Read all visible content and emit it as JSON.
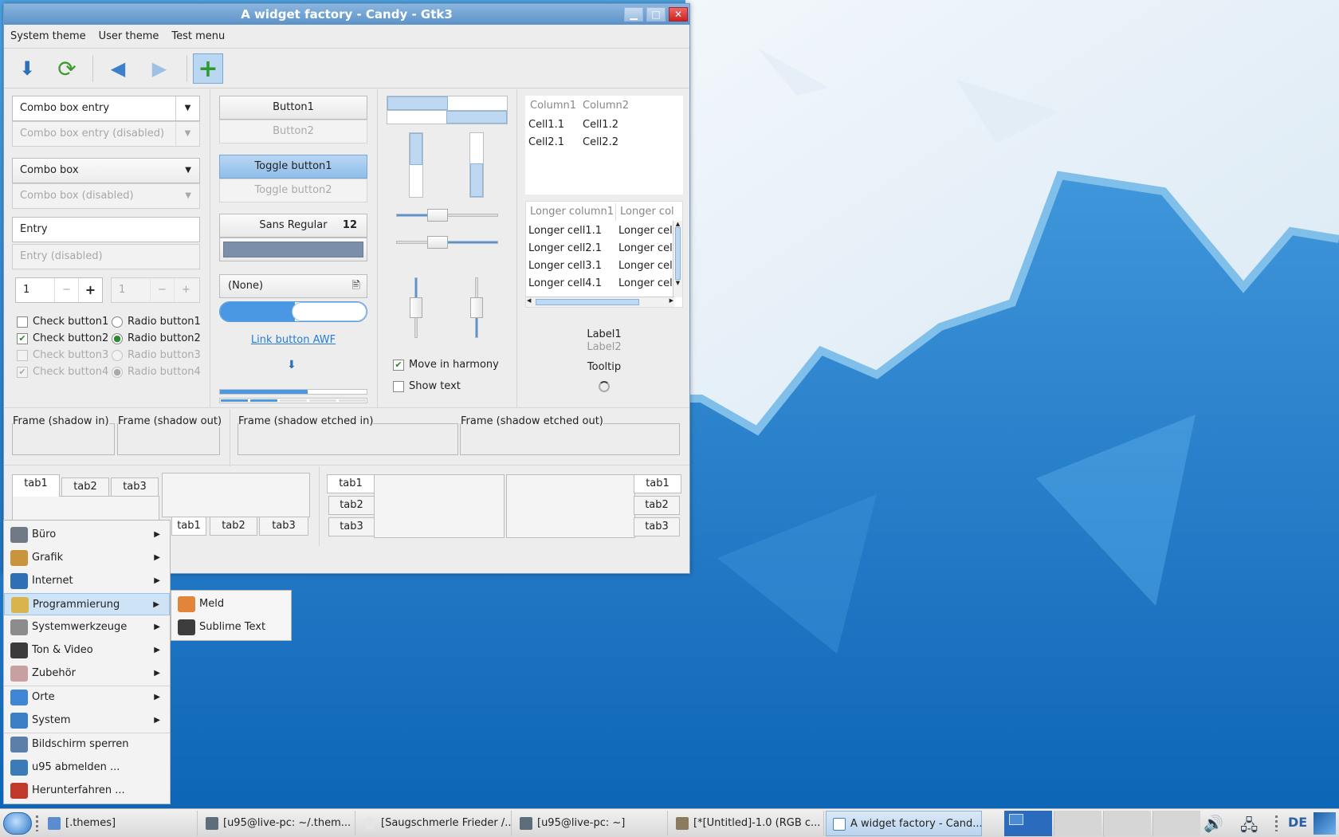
{
  "window": {
    "title": "A widget factory - Candy - Gtk3",
    "minimize_icon": "minimize-icon",
    "maximize_icon": "maximize-icon",
    "close_icon": "close-icon"
  },
  "menubar": {
    "items": [
      "System theme",
      "User theme",
      "Test menu"
    ]
  },
  "toolbar": {
    "icons": [
      "download-icon",
      "refresh-icon",
      "back-icon",
      "forward-icon",
      "add-icon"
    ]
  },
  "column1": {
    "combo_entry": "Combo box entry",
    "combo_entry_disabled": "Combo box entry (disabled)",
    "combo": "Combo box",
    "combo_disabled": "Combo box (disabled)",
    "entry": "Entry",
    "entry_disabled": "Entry (disabled)",
    "spin1_value": "1",
    "spin2_value": "1",
    "spin_minus": "−",
    "spin_plus": "+",
    "checks": [
      {
        "label": "Check button1",
        "checked": false,
        "disabled": false
      },
      {
        "label": "Check button2",
        "checked": true,
        "disabled": false
      },
      {
        "label": "Check button3",
        "checked": false,
        "disabled": true
      },
      {
        "label": "Check button4",
        "checked": true,
        "disabled": true
      }
    ],
    "radios": [
      {
        "label": "Radio button1",
        "checked": false,
        "disabled": false
      },
      {
        "label": "Radio button2",
        "checked": true,
        "disabled": false
      },
      {
        "label": "Radio button3",
        "checked": false,
        "disabled": true
      },
      {
        "label": "Radio button4",
        "checked": true,
        "disabled": true
      }
    ]
  },
  "column2": {
    "button1": "Button1",
    "button2": "Button2",
    "toggle1": "Toggle button1",
    "toggle2": "Toggle button2",
    "font_name": "Sans Regular",
    "font_size": "12",
    "file_chooser": "(None)",
    "link": "Link button AWF",
    "progress_level": 0.6
  },
  "column3": {
    "move_in_harmony": "Move in harmony",
    "show_text": "Show text",
    "hscale_level": 0.4,
    "vscale_level": 0.5
  },
  "column4": {
    "tree1_headers": [
      "Column1",
      "Column2"
    ],
    "tree1_rows": [
      [
        "Cell1.1",
        "Cell1.2"
      ],
      [
        "Cell2.1",
        "Cell2.2"
      ]
    ],
    "tree2_headers": [
      "Longer column1",
      "Longer col"
    ],
    "tree2_rows": [
      [
        "Longer cell1.1",
        "Longer cell"
      ],
      [
        "Longer cell2.1",
        "Longer cell"
      ],
      [
        "Longer cell3.1",
        "Longer cell"
      ],
      [
        "Longer cell4.1",
        "Longer cell"
      ]
    ],
    "label1": "Label1",
    "label2": "Label2",
    "tooltip": "Tooltip"
  },
  "frames": [
    "Frame (shadow in)",
    "Frame (shadow out)",
    "Frame (shadow etched in)",
    "Frame (shadow etched out)"
  ],
  "notebooks": {
    "tabs": [
      "tab1",
      "tab2",
      "tab3"
    ]
  },
  "appmenu": {
    "items": [
      {
        "label": "Büro",
        "submenu": true,
        "icon": "office-icon",
        "color": "#6f7a86"
      },
      {
        "label": "Grafik",
        "submenu": true,
        "icon": "graphics-icon",
        "color": "#c8953d"
      },
      {
        "label": "Internet",
        "submenu": true,
        "icon": "globe-icon",
        "color": "#2e6fb6"
      },
      {
        "label": "Programmierung",
        "submenu": true,
        "icon": "development-icon",
        "color": "#d9b44a",
        "selected": true
      },
      {
        "label": "Systemwerkzeuge",
        "submenu": true,
        "icon": "system-tools-icon",
        "color": "#8c8c8c"
      },
      {
        "label": "Ton & Video",
        "submenu": true,
        "icon": "multimedia-icon",
        "color": "#3b3b3b"
      },
      {
        "label": "Zubehör",
        "submenu": true,
        "icon": "accessories-icon",
        "color": "#c9a0a0"
      },
      {
        "label": "Orte",
        "submenu": true,
        "icon": "folder-icon",
        "color": "#3f87d4"
      },
      {
        "label": "System",
        "submenu": true,
        "icon": "computer-icon",
        "color": "#3c7fc6"
      },
      {
        "label": "Bildschirm sperren",
        "submenu": false,
        "icon": "lock-screen-icon",
        "color": "#5b7fa8"
      },
      {
        "label": "u95 abmelden ...",
        "submenu": false,
        "icon": "logout-icon",
        "color": "#3a7bb8"
      },
      {
        "label": "Herunterfahren ...",
        "submenu": false,
        "icon": "shutdown-icon",
        "color": "#c0392b"
      }
    ],
    "submenu": [
      {
        "label": "Meld",
        "icon": "meld-icon",
        "color": "#e2843a"
      },
      {
        "label": "Sublime Text",
        "icon": "sublime-icon",
        "color": "#3d3d3d"
      }
    ]
  },
  "taskbar": {
    "tasks": [
      "[.themes]",
      "[u95@live-pc: ~/.them...",
      "[Saugschmerle Frieder /...",
      "[u95@live-pc: ~]",
      "[*[Untitled]-1.0 (RGB c...",
      "A widget factory - Cand..."
    ],
    "active_task": "A widget factory - Cand...",
    "keyboard_layout": "DE"
  }
}
